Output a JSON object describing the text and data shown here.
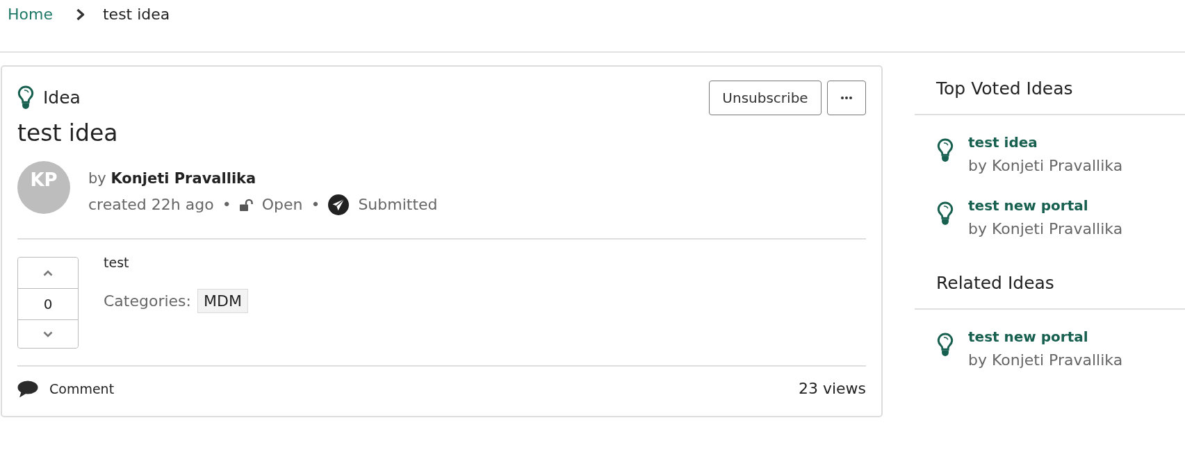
{
  "breadcrumb": [
    {
      "label": "Home",
      "kind": "link"
    },
    {
      "label": "test idea",
      "kind": "current"
    }
  ],
  "idea": {
    "type_label": "Idea",
    "title": "test idea",
    "subscribe_button": "Unsubscribe",
    "avatar_initials": "KP",
    "byline": "by **Konjeti Pravallika**",
    "meta": [
      {
        "kind": "created",
        "text": "created 22h ago"
      },
      {
        "kind": "bullet",
        "text": "•"
      },
      {
        "kind": "access",
        "text": "Open"
      },
      {
        "kind": "bullet",
        "text": "•"
      },
      {
        "kind": "stage",
        "text": "Submitted"
      }
    ],
    "votes": "0",
    "description": "test",
    "categories_label": "Categories:",
    "categories": [
      "MDM"
    ],
    "comment_label": "Comment",
    "views": "23 views"
  },
  "sidebar": [
    {
      "title": "Top Voted Ideas",
      "items": [
        {
          "title": "test idea",
          "author": "by Konjeti Pravallika"
        },
        {
          "title": "test new portal",
          "author": "by Konjeti Pravallika"
        }
      ]
    },
    {
      "title": "Related Ideas",
      "items": [
        {
          "title": "test new portal",
          "author": "by Konjeti Pravallika"
        }
      ]
    }
  ]
}
